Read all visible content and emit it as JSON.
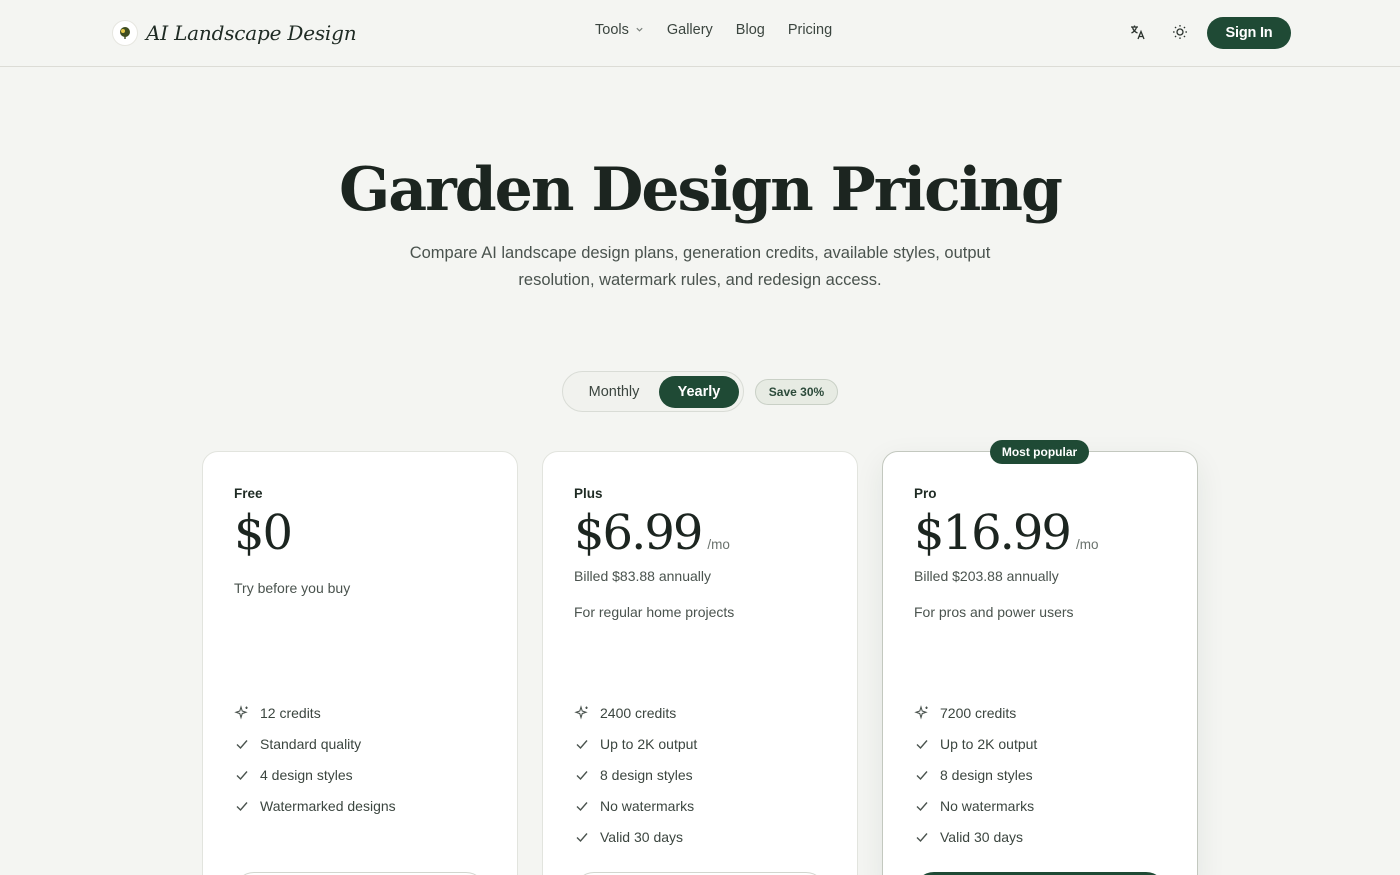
{
  "header": {
    "brand": "AI Landscape Design",
    "nav": [
      {
        "label": "Tools",
        "has_dropdown": true
      },
      {
        "label": "Gallery"
      },
      {
        "label": "Blog"
      },
      {
        "label": "Pricing"
      }
    ],
    "icons": {
      "language": "translate-icon",
      "theme": "sun-icon"
    },
    "sign_in": "Sign In"
  },
  "hero": {
    "title": "Garden Design Pricing",
    "subtitle": "Compare AI landscape design plans, generation credits, available styles, output resolution, watermark rules, and redesign access."
  },
  "billing_toggle": {
    "monthly": "Monthly",
    "yearly": "Yearly",
    "selected": "Yearly",
    "save_badge": "Save 30%"
  },
  "plans": [
    {
      "name": "Free",
      "price": "$0",
      "per": "",
      "billed": "",
      "tagline": "Try before you buy",
      "features": [
        "12 credits",
        "Standard quality",
        "4 design styles",
        "Watermarked designs"
      ]
    },
    {
      "name": "Plus",
      "price": "$6.99",
      "per": "/mo",
      "billed": "Billed $83.88 annually",
      "tagline": "For regular home projects",
      "features": [
        "2400 credits",
        "Up to 2K output",
        "8 design styles",
        "No watermarks",
        "Valid 30 days"
      ]
    },
    {
      "name": "Pro",
      "badge": "Most popular",
      "price": "$16.99",
      "per": "/mo",
      "billed": "Billed $203.88 annually",
      "tagline": "For pros and power users",
      "features": [
        "7200 credits",
        "Up to 2K output",
        "8 design styles",
        "No watermarks",
        "Valid 30 days"
      ]
    }
  ],
  "colors": {
    "brand": "#1f4a35",
    "background": "#f4f5f2",
    "card": "#ffffff"
  }
}
